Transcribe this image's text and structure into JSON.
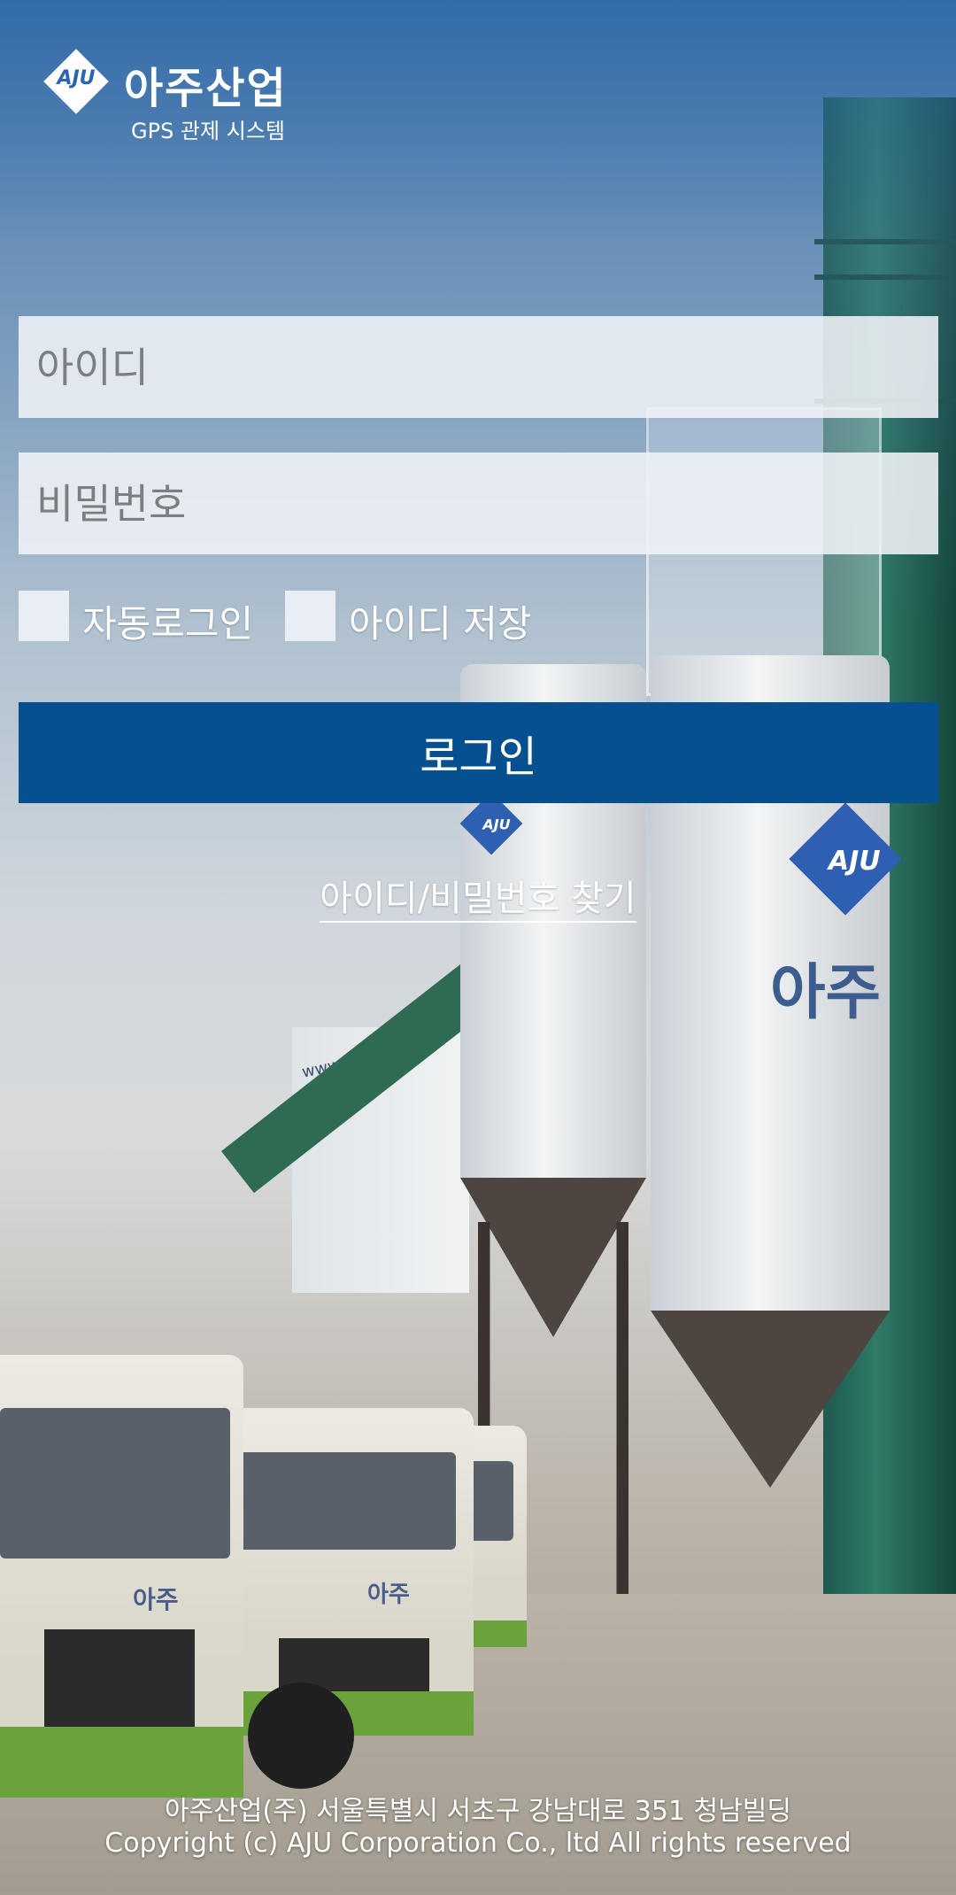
{
  "brand": {
    "mark_text": "AJU",
    "name": "아주산업",
    "subtitle": "GPS 관제 시스템"
  },
  "login_form": {
    "id_placeholder": "아이디",
    "id_value": "",
    "password_placeholder": "비밀번호",
    "password_value": "",
    "auto_login_label": "자동로그인",
    "auto_login_checked": false,
    "save_id_label": "아이디 저장",
    "save_id_checked": false,
    "login_button_label": "로그인",
    "find_link_label": "아이디/비밀번호 찾기"
  },
  "background": {
    "building_url": "www.aju.co.kr",
    "silo_logo": "AJU",
    "silo_text": "아주",
    "truck_text": "아주"
  },
  "footer": {
    "address": "아주산업(주) 서울특별시 서초구 강남대로 351 청남빌딩",
    "copyright": "Copyright (c) AJU Corporation Co., ltd All rights reserved"
  },
  "colors": {
    "login_button": "#06508f",
    "field_background": "#eef1f5",
    "brand_blue": "#2b64b3"
  }
}
